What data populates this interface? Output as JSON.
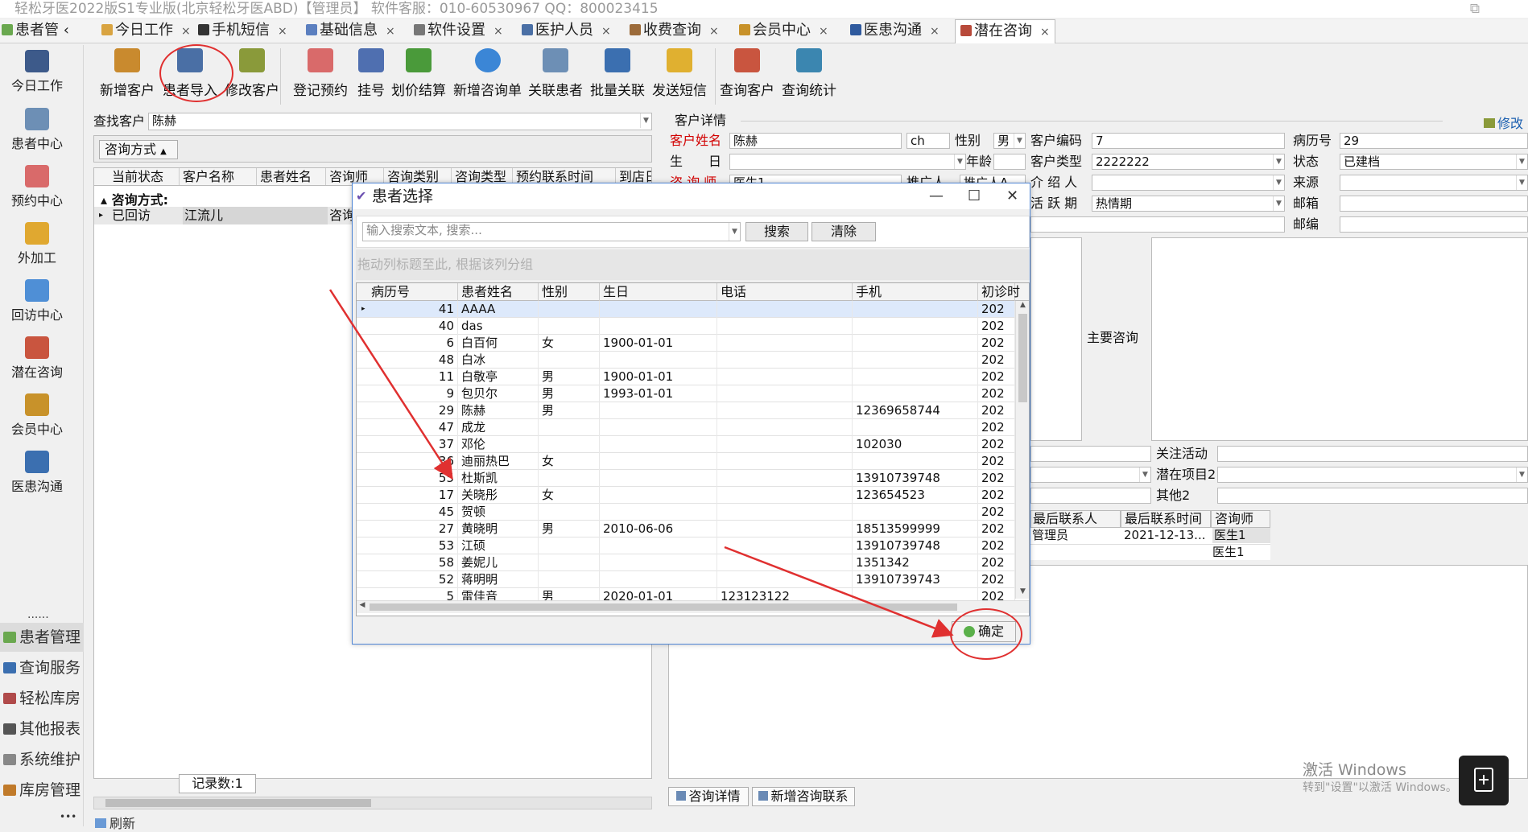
{
  "window": {
    "title": "轻松牙医2022版S1专业版(北京轻松牙医ABD)【管理员】    软件客服：010-60530967  QQ：800023415",
    "restore_glyph": "⧉"
  },
  "tabs": {
    "home": "患者管",
    "home_arrow": "‹",
    "close_glyph": "×",
    "items": [
      "今日工作",
      "手机短信",
      "基础信息",
      "软件设置",
      "医护人员",
      "收费查询",
      "会员中心",
      "医患沟通",
      "潜在咨询"
    ]
  },
  "leftnav": {
    "items": [
      "今日工作",
      "患者中心",
      "预约中心",
      "外加工",
      "回访中心",
      "潜在咨询",
      "会员中心",
      "医患沟通"
    ],
    "dots": "......",
    "list": [
      "患者管理",
      "查询服务",
      "轻松库房",
      "其他报表",
      "系统维护",
      "库房管理"
    ],
    "bottom_dots": "•••"
  },
  "ribbon": {
    "buttons": [
      "新增客户",
      "患者导入",
      "修改客户",
      "登记预约",
      "挂号",
      "划价结算",
      "新增咨询单",
      "关联患者",
      "批量关联",
      "发送短信",
      "查询客户",
      "查询统计"
    ]
  },
  "search": {
    "label": "查找客户",
    "value": "陈赫",
    "group_label": "咨询方式",
    "group_arrow": "▲"
  },
  "left_grid": {
    "headers": [
      "当前状态",
      "客户名称",
      "患者姓名",
      "咨询师",
      "咨询类别",
      "咨询类型",
      "预约联系时间",
      "到店日"
    ],
    "group_row": "咨询方式:",
    "row": {
      "status": "已回访",
      "name": "江流儿",
      "col4": "咨询"
    },
    "record_count": "记录数:1",
    "refresh": "刷新"
  },
  "detail": {
    "section_title": "客户详情",
    "edit_label": "修改",
    "name_label": "客户姓名",
    "name_value": "陈赫",
    "abbr": "ch",
    "gender_label": "性别",
    "gender_value": "男",
    "code_label": "客户编码",
    "code_value": "7",
    "record_label": "病历号",
    "record_value": "29",
    "birthday_label": "生　　日",
    "age_label": "年龄",
    "type_label": "客户类型",
    "type_value": "2222222",
    "state_label": "状态",
    "state_value": "已建档",
    "consultant_label": "咨 询 师",
    "consultant_value": "医生1",
    "promoter_label": "推广人",
    "promoter_value": "推广人A",
    "referrer_label": "介 绍 人",
    "source_label": "来源",
    "active_label": "活 跃 期",
    "active_value": "热情期",
    "email_label": "邮箱",
    "email2_label": "邮编",
    "main_consult_label": "主要咨询",
    "activity_label": "关注活动",
    "potential_label": "潜在项目2",
    "other_label": "其他2",
    "contact_headers": [
      "最后联系人",
      "最后联系时间",
      "咨询师"
    ],
    "contact_rows": [
      {
        "person": "管理员",
        "time": "2021-12-13...",
        "consultant": "医生1"
      },
      {
        "person": "",
        "time": "",
        "consultant": "医生1"
      }
    ],
    "bottom_tabs": [
      "咨询详情",
      "新增咨询联系"
    ]
  },
  "dialog": {
    "title": "患者选择",
    "minimize": "—",
    "maximize": "☐",
    "close": "✕",
    "search_placeholder": "输入搜索文本, 搜索...",
    "search_button": "搜索",
    "clear_button": "清除",
    "group_hint": "拖动列标题至此, 根据该列分组",
    "headers": [
      "病历号",
      "患者姓名",
      "性别",
      "生日",
      "电话",
      "手机",
      "初诊时"
    ],
    "rows": [
      {
        "id": "41",
        "name": "AAAA",
        "gender": "",
        "birthday": "",
        "phone": "",
        "mobile": "",
        "first": "202"
      },
      {
        "id": "40",
        "name": "das",
        "gender": "",
        "birthday": "",
        "phone": "",
        "mobile": "",
        "first": "202"
      },
      {
        "id": "6",
        "name": "白百何",
        "gender": "女",
        "birthday": "1900-01-01",
        "phone": "",
        "mobile": "",
        "first": "202"
      },
      {
        "id": "48",
        "name": "白冰",
        "gender": "",
        "birthday": "",
        "phone": "",
        "mobile": "",
        "first": "202"
      },
      {
        "id": "11",
        "name": "白敬亭",
        "gender": "男",
        "birthday": "1900-01-01",
        "phone": "",
        "mobile": "",
        "first": "202"
      },
      {
        "id": "9",
        "name": "包贝尔",
        "gender": "男",
        "birthday": "1993-01-01",
        "phone": "",
        "mobile": "",
        "first": "202"
      },
      {
        "id": "29",
        "name": "陈赫",
        "gender": "男",
        "birthday": "",
        "phone": "",
        "mobile": "12369658744",
        "first": "202"
      },
      {
        "id": "47",
        "name": "成龙",
        "gender": "",
        "birthday": "",
        "phone": "",
        "mobile": "",
        "first": "202"
      },
      {
        "id": "37",
        "name": "邓伦",
        "gender": "",
        "birthday": "",
        "phone": "",
        "mobile": "102030",
        "first": "202"
      },
      {
        "id": "36",
        "name": "迪丽热巴",
        "gender": "女",
        "birthday": "",
        "phone": "",
        "mobile": "",
        "first": "202"
      },
      {
        "id": "55",
        "name": "杜斯凯",
        "gender": "",
        "birthday": "",
        "phone": "",
        "mobile": "13910739748",
        "first": "202"
      },
      {
        "id": "17",
        "name": "关晓彤",
        "gender": "女",
        "birthday": "",
        "phone": "",
        "mobile": "123654523",
        "first": "202"
      },
      {
        "id": "45",
        "name": "贺顿",
        "gender": "",
        "birthday": "",
        "phone": "",
        "mobile": "",
        "first": "202"
      },
      {
        "id": "27",
        "name": "黄晓明",
        "gender": "男",
        "birthday": "2010-06-06",
        "phone": "",
        "mobile": "18513599999",
        "first": "202"
      },
      {
        "id": "53",
        "name": "江硕",
        "gender": "",
        "birthday": "",
        "phone": "",
        "mobile": "13910739748",
        "first": "202"
      },
      {
        "id": "58",
        "name": "姜妮儿",
        "gender": "",
        "birthday": "",
        "phone": "",
        "mobile": "1351342",
        "first": "202"
      },
      {
        "id": "52",
        "name": "蒋明明",
        "gender": "",
        "birthday": "",
        "phone": "",
        "mobile": "13910739743",
        "first": "202"
      },
      {
        "id": "5",
        "name": "雷佳音",
        "gender": "男",
        "birthday": "2020-01-01",
        "phone": "123123122",
        "mobile": "",
        "first": "202"
      }
    ],
    "confirm_button": "确定"
  },
  "watermark": {
    "line1": "激活 Windows",
    "line2": "转到\"设置\"以激活 Windows。"
  },
  "colors": {
    "annotation": "#e03030",
    "selection": "#dde9fb",
    "dialog_border": "#4f86d6"
  }
}
